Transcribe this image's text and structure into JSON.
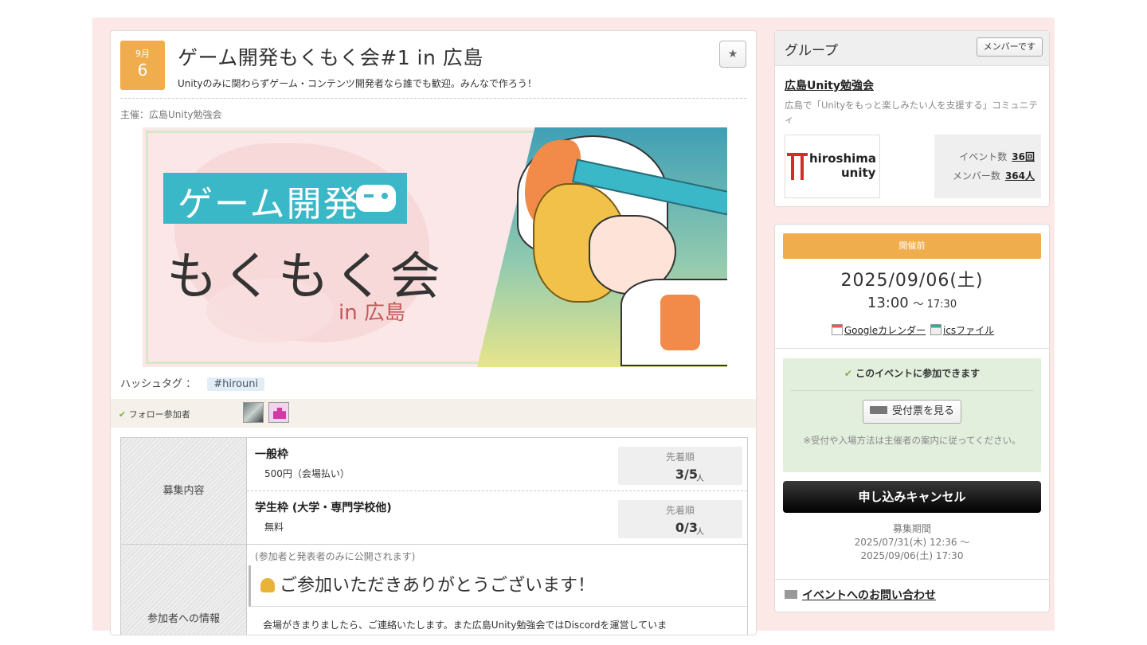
{
  "event": {
    "month": "9月",
    "day": "6",
    "title": "ゲーム開発もくもく会#1 in 広島",
    "subtitle": "Unityのみに関わらずゲーム・コンテンツ開発者なら誰でも歓迎。みんなで作ろう！",
    "organizer": "主催：広島Unity勉強会",
    "star_icon": "★",
    "banner": {
      "line1": "ゲーム開発",
      "line2": "もくもく会",
      "line3": "in 広島"
    },
    "hashtag_label": "ハッシュタグ ：",
    "hashtag": "#hirouni",
    "follow_label": "フォロー参加者",
    "check_icon": "✔"
  },
  "tickets": {
    "header": "募集内容",
    "items": [
      {
        "name": "一般枠",
        "price": "500円（会場払い）",
        "order_label": "先着順",
        "count": "3/5",
        "unit": "人"
      },
      {
        "name": "学生枠 (大学・専門学校他)",
        "price": "無料",
        "order_label": "先着順",
        "count": "0/3",
        "unit": "人"
      }
    ]
  },
  "participant_info": {
    "header": "参加者への情報",
    "note": "(参加者と発表者のみに公開されます)",
    "thanks": "ご参加いただきありがとうございます！",
    "body_text": "会場がきまりましたら、ご連絡いたします。また広島Unity勉強会ではDiscordを運営していま"
  },
  "group": {
    "header": "グループ",
    "member_button": "メンバーです",
    "name": "広島Unity勉強会",
    "description": "広島で「Unityをもっと楽しみたい人を支援する」コミュニティ",
    "logo_line1": "hiroshima",
    "logo_line2": "unity",
    "events_label": "イベント数",
    "events_count": "36回",
    "members_label": "メンバー数",
    "members_count": "364人"
  },
  "schedule": {
    "status": "開催前",
    "date": "2025/09/06(土)",
    "start_time": "13:00",
    "end_time": "〜 17:30",
    "google_calendar": "Googleカレンダー",
    "ics_file": "icsファイル",
    "join_status": "このイベントに参加できます",
    "ticket_button": "受付票を見る",
    "join_note": "※受付や入場方法は主催者の案内に従ってください。",
    "cancel_button": "申し込みキャンセル",
    "recruit_label": "募集期間",
    "recruit_start": "2025/07/31(木) 12:36 〜",
    "recruit_end": "2025/09/06(土) 17:30",
    "contact": "イベントへのお問い合わせ"
  }
}
